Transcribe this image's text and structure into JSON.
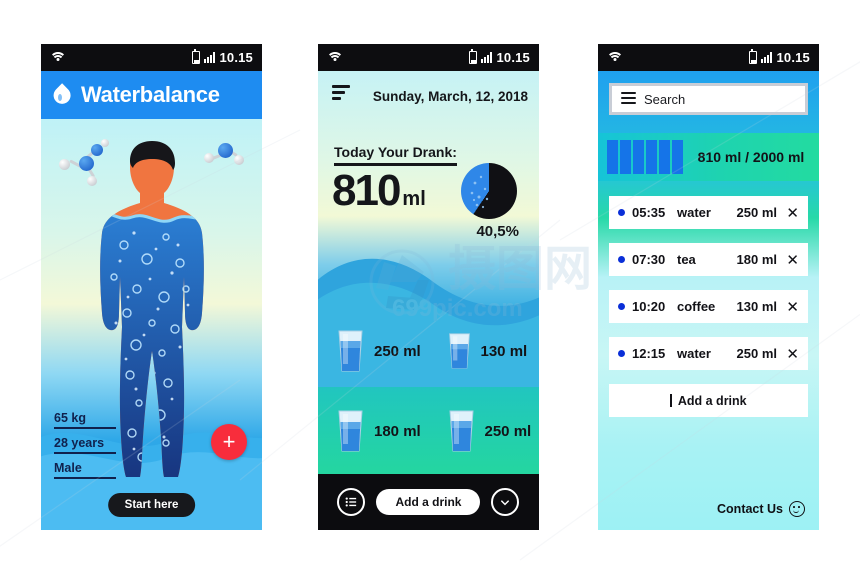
{
  "statusbar": {
    "time": "10.15",
    "wifi_icon": "wifi-icon",
    "battery_icon": "battery-icon",
    "signal_icon": "signal-bars-icon"
  },
  "left_screen": {
    "app_title": "Waterbalance",
    "logo_icon": "water-drop-icon",
    "stats": [
      {
        "key": "weight",
        "value": "65 kg"
      },
      {
        "key": "age",
        "value": "28 years"
      },
      {
        "key": "gender",
        "value": "Male"
      }
    ],
    "add_button_icon": "plus-icon",
    "start_button": "Start here"
  },
  "middle_screen": {
    "menu_icon": "hamburger-menu-icon",
    "date": "Sunday, March, 12, 2018",
    "drank_label": "Today Your Drank:",
    "drank_amount": "810",
    "drank_unit": "ml",
    "percent": "40,5%",
    "pie": {
      "consumed_pct": 40.5,
      "remaining_pct": 59.5,
      "consumed_color": "#2f87e8",
      "remaining_color": "#101014"
    },
    "glasses": [
      {
        "amount": "250 ml"
      },
      {
        "amount": "130 ml"
      },
      {
        "amount": "180 ml"
      },
      {
        "amount": "250 ml"
      }
    ],
    "footer": {
      "list_icon": "list-view-icon",
      "add_button": "Add a drink",
      "chevron_icon": "chevron-down-icon"
    }
  },
  "right_screen": {
    "search": {
      "icon": "hamburger-menu-icon",
      "placeholder": "Search",
      "value": "Search"
    },
    "progress": {
      "current": "810 ml",
      "goal": "2000 ml",
      "text": "810 ml / 2000 ml",
      "filled_bars": 6,
      "total_bars": 12,
      "bar_color": "#1574e8"
    },
    "drinks": [
      {
        "time": "05:35",
        "type": "water",
        "amount": "250 ml",
        "remove_icon": "close-icon"
      },
      {
        "time": "07:30",
        "type": "tea",
        "amount": "180 ml",
        "remove_icon": "close-icon"
      },
      {
        "time": "10:20",
        "type": "coffee",
        "amount": "130 ml",
        "remove_icon": "close-icon"
      },
      {
        "time": "12:15",
        "type": "water",
        "amount": "250 ml",
        "remove_icon": "close-icon"
      }
    ],
    "add_drink": "Add a drink",
    "contact": {
      "label": "Contact Us",
      "icon": "smiley-face-icon"
    }
  },
  "watermark": {
    "text": "699pic.com",
    "cn_text": "摄图网"
  },
  "colors": {
    "brand_blue": "#1e8cf1",
    "accent_red": "#f82d3c",
    "teal": "#23dba0",
    "dark": "#0c0c0f"
  }
}
